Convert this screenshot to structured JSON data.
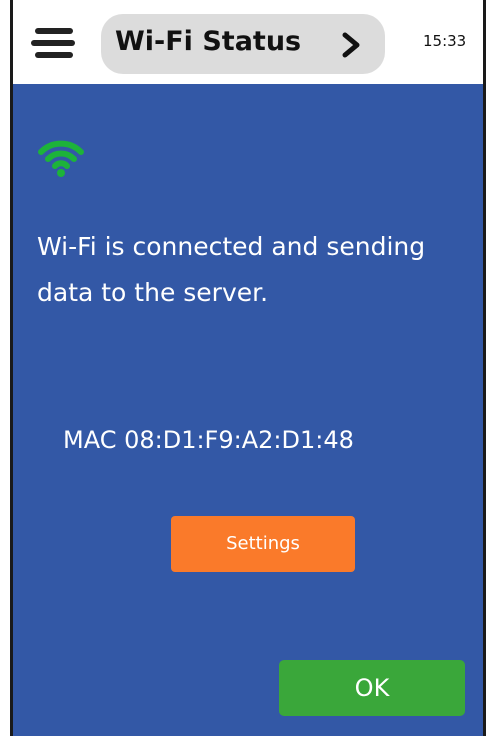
{
  "header": {
    "title": "Wi-Fi Status",
    "clock": "15:33",
    "menu_icon": "hamburger-menu-icon",
    "chevron_icon": "chevron-right-icon"
  },
  "status": {
    "wifi_icon": "wifi-connected-icon",
    "wifi_icon_color": "#1db33a",
    "message": "Wi-Fi is connected and sending data to the server.",
    "mac": "MAC 08:D1:F9:A2:D1:48"
  },
  "buttons": {
    "settings_label": "Settings",
    "settings_color": "#fa7a2a",
    "ok_label": "OK",
    "ok_color": "#3aa73a"
  },
  "colors": {
    "panel_background": "#3358a6",
    "header_background": "#ffffff",
    "title_pill": "#dcdcdc"
  }
}
